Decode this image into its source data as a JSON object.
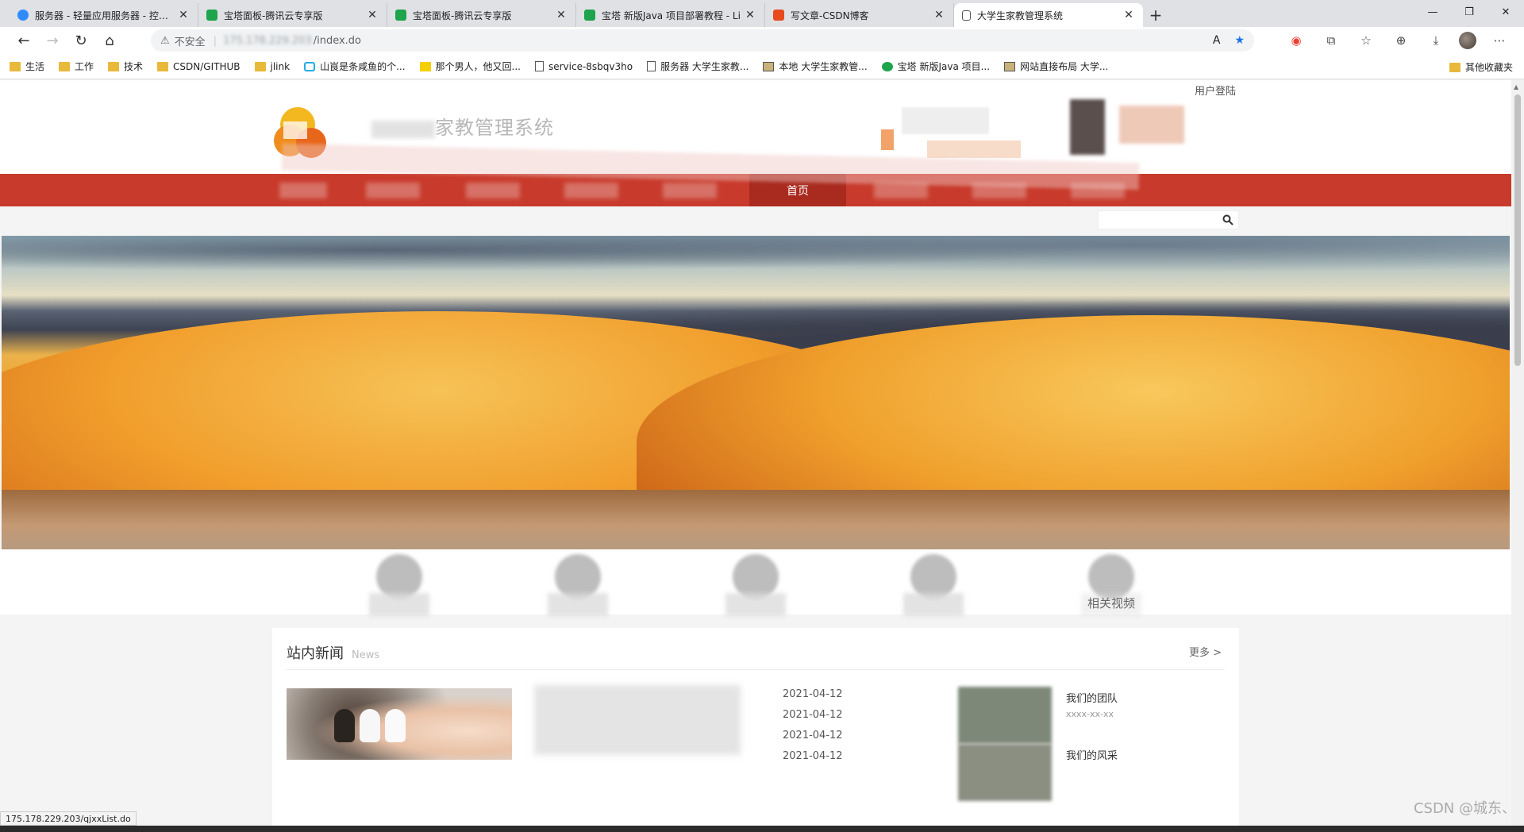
{
  "browser": {
    "tabs": [
      {
        "title": "服务器 - 轻量应用服务器 - 控制台",
        "favicon_color": "#2f8cff"
      },
      {
        "title": "宝塔面板-腾讯云专享版",
        "favicon_color": "#1da44c"
      },
      {
        "title": "宝塔面板-腾讯云专享版",
        "favicon_color": "#1da44c"
      },
      {
        "title": "宝塔 新版Java 项目部署教程 - Li",
        "favicon_color": "#1da44c"
      },
      {
        "title": "写文章-CSDN博客",
        "favicon_color": "#e8491d"
      },
      {
        "title": "大学生家教管理系统",
        "favicon_color": "#ffffff",
        "active": true
      }
    ],
    "new_tab_label": "+",
    "window_controls": {
      "minimize": "—",
      "restore": "❐",
      "close": "✕"
    },
    "address": {
      "security_label": "不安全",
      "host": "175.178.229.203",
      "path": "/index.do"
    },
    "bookmarks": [
      {
        "label": "生活",
        "type": "folder"
      },
      {
        "label": "工作",
        "type": "folder"
      },
      {
        "label": "技术",
        "type": "folder"
      },
      {
        "label": "CSDN/GITHUB",
        "type": "folder"
      },
      {
        "label": "jlink",
        "type": "folder"
      },
      {
        "label": "山峎是条咸鱼的个...",
        "type": "link"
      },
      {
        "label": "那个男人，他又回...",
        "type": "link"
      },
      {
        "label": "service-8sbqv3ho",
        "type": "page"
      },
      {
        "label": "服务器 大学生家教...",
        "type": "page"
      },
      {
        "label": "本地 大学生家教管...",
        "type": "link"
      },
      {
        "label": "宝塔 新版Java 项目...",
        "type": "link"
      },
      {
        "label": "网站直接布局 大学...",
        "type": "link"
      }
    ],
    "bookmarks_other": "其他收藏夹",
    "status_url": "175.178.229.203/qjxxList.do"
  },
  "site": {
    "login_link": "用户登陆",
    "title_suffix": "家教管理系统",
    "nav_active": "首页",
    "search_placeholder": "",
    "features_last_label": "相关视频",
    "news": {
      "title": "站内新闻",
      "subtitle": "News",
      "more": "更多 >",
      "dates": [
        "2021-04-12",
        "2021-04-12",
        "2021-04-12",
        "2021-04-12"
      ],
      "side_items": [
        {
          "title": "我们的团队",
          "date": "xxxx-xx-xx"
        },
        {
          "title": "我们的风采",
          "date": ""
        }
      ]
    }
  },
  "watermark": "CSDN @城东、"
}
